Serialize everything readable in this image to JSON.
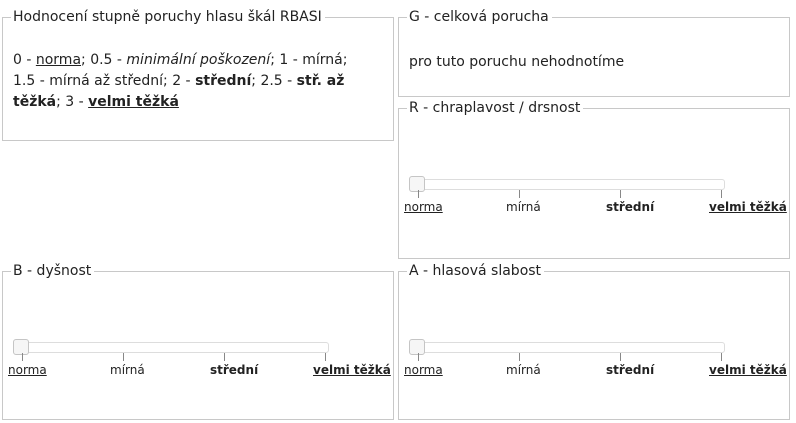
{
  "scale": {
    "title": "Hodnocení stupně poruchy hlasu škál RBASI",
    "p1": "0 - ",
    "p2": "norma",
    "p3": "; 0.5 - ",
    "p4": "minimální poškození",
    "p5": "; 1 - mírná;",
    "p6": "1.5 - mírná až střední; 2 - ",
    "p7": "střední",
    "p8": "; 2.5 - ",
    "p9": "stř. až těžká",
    "p10": "; 3 - ",
    "p11": "velmi těžká"
  },
  "g": {
    "title": "G - celková porucha",
    "text": "pro tuto poruchu nehodnotíme"
  },
  "r": {
    "title": "R - chraplavost / drsnost",
    "value": 0
  },
  "b": {
    "title": "B - dyšnost",
    "value": 0
  },
  "a": {
    "title": "A - hlasová slabost",
    "value": 0
  },
  "ticks": [
    "norma",
    "mírná",
    "střední",
    "velmi těžká"
  ],
  "colors": {
    "border": "#c8c8c8",
    "handle": "#f6f6f6",
    "track": "#ffffff"
  }
}
